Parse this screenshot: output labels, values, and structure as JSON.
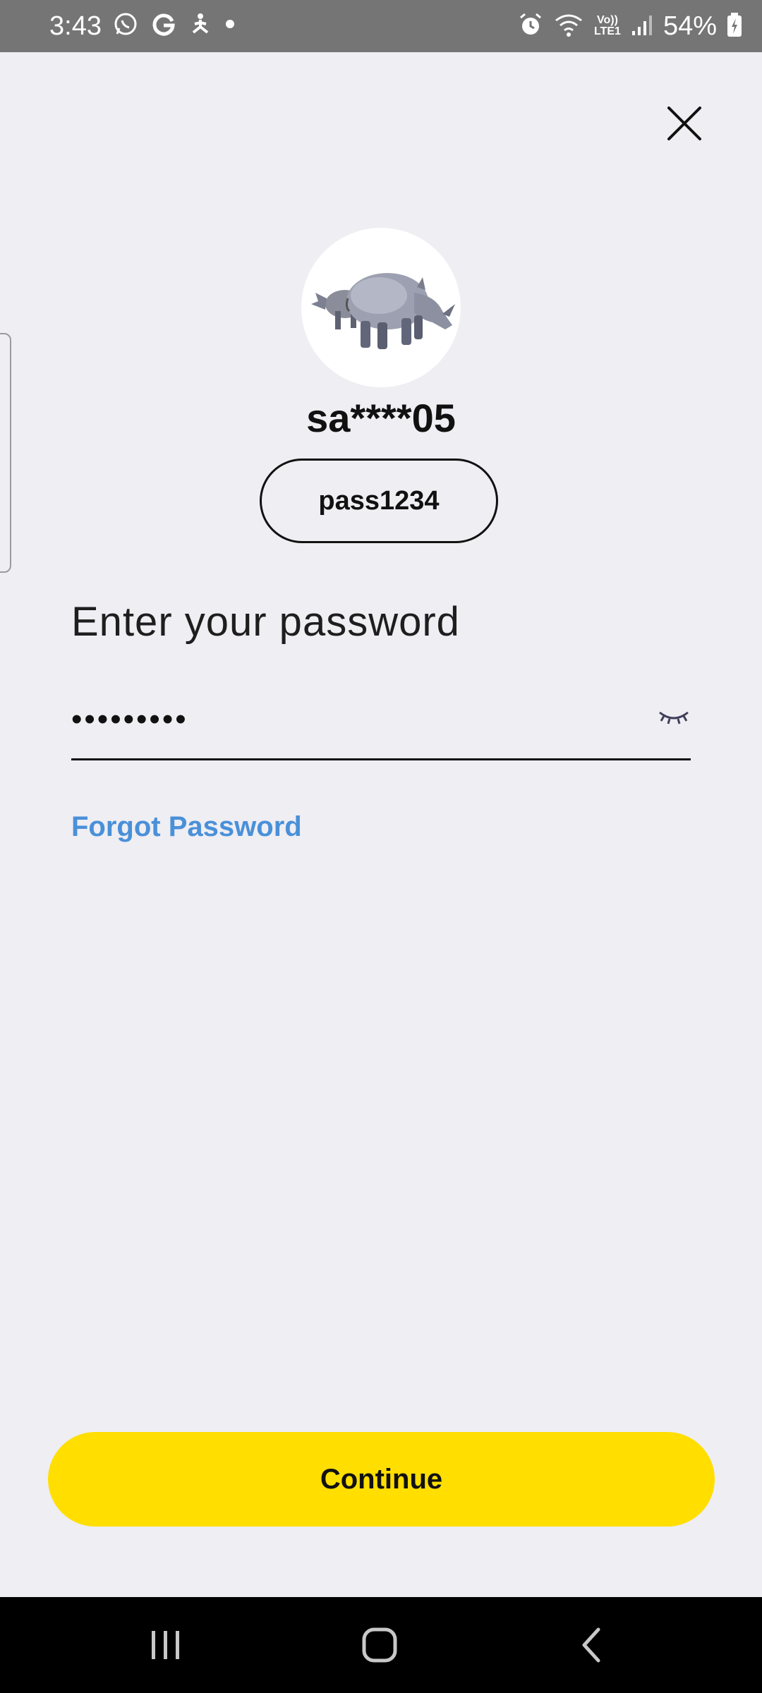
{
  "status_bar": {
    "time": "3:43",
    "battery_percent": "54%",
    "network_label": "LTE1",
    "volte_label": "Vo))",
    "icons": [
      "whatsapp-icon",
      "google-icon",
      "yoga-icon",
      "dot-icon",
      "alarm-icon",
      "wifi-icon",
      "signal-icon",
      "battery-icon"
    ]
  },
  "header": {
    "close_icon": "close-icon"
  },
  "profile": {
    "avatar_icon": "rhino-avatar",
    "username": "sa****05",
    "pill_label": "pass1234"
  },
  "form": {
    "label": "Enter your password",
    "password_value": "•••••••••",
    "toggle_icon": "eye-closed-icon",
    "forgot_label": "Forgot Password"
  },
  "actions": {
    "continue_label": "Continue"
  },
  "nav_bar": {
    "icons": [
      "recents-icon",
      "home-icon",
      "back-icon"
    ]
  },
  "colors": {
    "background": "#eeeef3",
    "accent_button": "#ffde00",
    "link": "#4a90d9",
    "status_bar": "#757575"
  }
}
